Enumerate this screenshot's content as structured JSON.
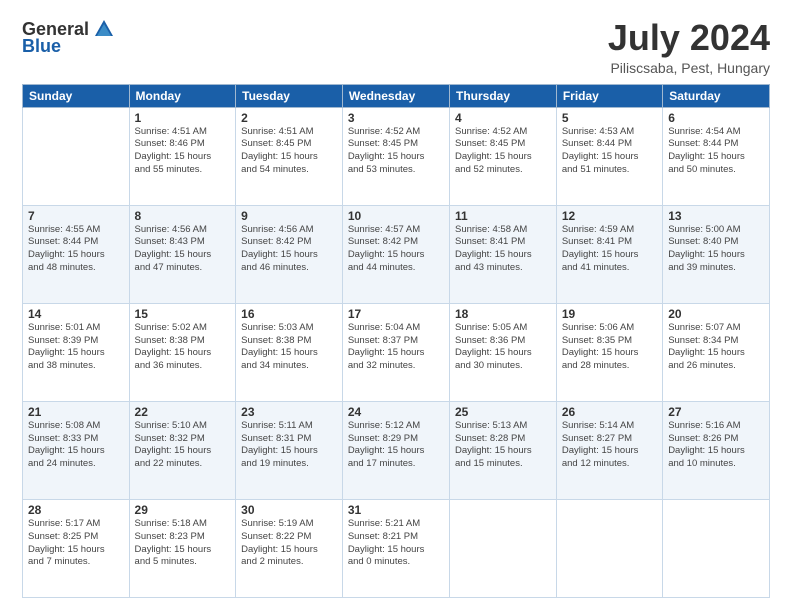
{
  "logo": {
    "general": "General",
    "blue": "Blue"
  },
  "header": {
    "title": "July 2024",
    "location": "Piliscsaba, Pest, Hungary"
  },
  "weekdays": [
    "Sunday",
    "Monday",
    "Tuesday",
    "Wednesday",
    "Thursday",
    "Friday",
    "Saturday"
  ],
  "weeks": [
    [
      {
        "day": "",
        "info": ""
      },
      {
        "day": "1",
        "info": "Sunrise: 4:51 AM\nSunset: 8:46 PM\nDaylight: 15 hours\nand 55 minutes."
      },
      {
        "day": "2",
        "info": "Sunrise: 4:51 AM\nSunset: 8:45 PM\nDaylight: 15 hours\nand 54 minutes."
      },
      {
        "day": "3",
        "info": "Sunrise: 4:52 AM\nSunset: 8:45 PM\nDaylight: 15 hours\nand 53 minutes."
      },
      {
        "day": "4",
        "info": "Sunrise: 4:52 AM\nSunset: 8:45 PM\nDaylight: 15 hours\nand 52 minutes."
      },
      {
        "day": "5",
        "info": "Sunrise: 4:53 AM\nSunset: 8:44 PM\nDaylight: 15 hours\nand 51 minutes."
      },
      {
        "day": "6",
        "info": "Sunrise: 4:54 AM\nSunset: 8:44 PM\nDaylight: 15 hours\nand 50 minutes."
      }
    ],
    [
      {
        "day": "7",
        "info": "Sunrise: 4:55 AM\nSunset: 8:44 PM\nDaylight: 15 hours\nand 48 minutes."
      },
      {
        "day": "8",
        "info": "Sunrise: 4:56 AM\nSunset: 8:43 PM\nDaylight: 15 hours\nand 47 minutes."
      },
      {
        "day": "9",
        "info": "Sunrise: 4:56 AM\nSunset: 8:42 PM\nDaylight: 15 hours\nand 46 minutes."
      },
      {
        "day": "10",
        "info": "Sunrise: 4:57 AM\nSunset: 8:42 PM\nDaylight: 15 hours\nand 44 minutes."
      },
      {
        "day": "11",
        "info": "Sunrise: 4:58 AM\nSunset: 8:41 PM\nDaylight: 15 hours\nand 43 minutes."
      },
      {
        "day": "12",
        "info": "Sunrise: 4:59 AM\nSunset: 8:41 PM\nDaylight: 15 hours\nand 41 minutes."
      },
      {
        "day": "13",
        "info": "Sunrise: 5:00 AM\nSunset: 8:40 PM\nDaylight: 15 hours\nand 39 minutes."
      }
    ],
    [
      {
        "day": "14",
        "info": "Sunrise: 5:01 AM\nSunset: 8:39 PM\nDaylight: 15 hours\nand 38 minutes."
      },
      {
        "day": "15",
        "info": "Sunrise: 5:02 AM\nSunset: 8:38 PM\nDaylight: 15 hours\nand 36 minutes."
      },
      {
        "day": "16",
        "info": "Sunrise: 5:03 AM\nSunset: 8:38 PM\nDaylight: 15 hours\nand 34 minutes."
      },
      {
        "day": "17",
        "info": "Sunrise: 5:04 AM\nSunset: 8:37 PM\nDaylight: 15 hours\nand 32 minutes."
      },
      {
        "day": "18",
        "info": "Sunrise: 5:05 AM\nSunset: 8:36 PM\nDaylight: 15 hours\nand 30 minutes."
      },
      {
        "day": "19",
        "info": "Sunrise: 5:06 AM\nSunset: 8:35 PM\nDaylight: 15 hours\nand 28 minutes."
      },
      {
        "day": "20",
        "info": "Sunrise: 5:07 AM\nSunset: 8:34 PM\nDaylight: 15 hours\nand 26 minutes."
      }
    ],
    [
      {
        "day": "21",
        "info": "Sunrise: 5:08 AM\nSunset: 8:33 PM\nDaylight: 15 hours\nand 24 minutes."
      },
      {
        "day": "22",
        "info": "Sunrise: 5:10 AM\nSunset: 8:32 PM\nDaylight: 15 hours\nand 22 minutes."
      },
      {
        "day": "23",
        "info": "Sunrise: 5:11 AM\nSunset: 8:31 PM\nDaylight: 15 hours\nand 19 minutes."
      },
      {
        "day": "24",
        "info": "Sunrise: 5:12 AM\nSunset: 8:29 PM\nDaylight: 15 hours\nand 17 minutes."
      },
      {
        "day": "25",
        "info": "Sunrise: 5:13 AM\nSunset: 8:28 PM\nDaylight: 15 hours\nand 15 minutes."
      },
      {
        "day": "26",
        "info": "Sunrise: 5:14 AM\nSunset: 8:27 PM\nDaylight: 15 hours\nand 12 minutes."
      },
      {
        "day": "27",
        "info": "Sunrise: 5:16 AM\nSunset: 8:26 PM\nDaylight: 15 hours\nand 10 minutes."
      }
    ],
    [
      {
        "day": "28",
        "info": "Sunrise: 5:17 AM\nSunset: 8:25 PM\nDaylight: 15 hours\nand 7 minutes."
      },
      {
        "day": "29",
        "info": "Sunrise: 5:18 AM\nSunset: 8:23 PM\nDaylight: 15 hours\nand 5 minutes."
      },
      {
        "day": "30",
        "info": "Sunrise: 5:19 AM\nSunset: 8:22 PM\nDaylight: 15 hours\nand 2 minutes."
      },
      {
        "day": "31",
        "info": "Sunrise: 5:21 AM\nSunset: 8:21 PM\nDaylight: 15 hours\nand 0 minutes."
      },
      {
        "day": "",
        "info": ""
      },
      {
        "day": "",
        "info": ""
      },
      {
        "day": "",
        "info": ""
      }
    ]
  ]
}
